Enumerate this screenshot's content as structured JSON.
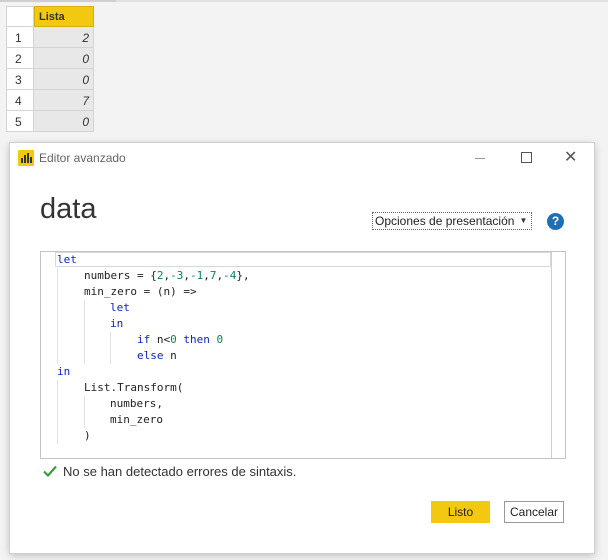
{
  "table": {
    "column_header": "Lista",
    "rows": [
      {
        "index": "1",
        "value": "2"
      },
      {
        "index": "2",
        "value": "0"
      },
      {
        "index": "3",
        "value": "0"
      },
      {
        "index": "4",
        "value": "7"
      },
      {
        "index": "5",
        "value": "0"
      }
    ]
  },
  "dialog": {
    "title": "Editor avanzado",
    "query_name": "data",
    "display_options_label": "Opciones de presentación",
    "help_label": "?",
    "close_label": "✕",
    "code": {
      "l1": "let",
      "l2_a": "numbers = {",
      "l2_n1": "2",
      "l2_n2": "-3",
      "l2_n3": "-1",
      "l2_n4": "7",
      "l2_n5": "-4",
      "l2_b": "},",
      "l3": "min_zero = (n) =>",
      "l4": "let",
      "l5": "in",
      "l6_if": "if",
      "l6_cond": " n<",
      "l6_n0": "0",
      "l6_then": "then",
      "l6_n1": "0",
      "l7_else": "else",
      "l7_n": " n",
      "l8": "in",
      "l9": "List.Transform(",
      "l10": "numbers,",
      "l11": "min_zero",
      "l12": ")"
    },
    "status_message": "No se han detectado errores de sintaxis.",
    "ok_label": "Listo",
    "cancel_label": "Cancelar"
  },
  "colors": {
    "accent": "#f2c811",
    "keyword": "#0e23c7",
    "number": "#098658",
    "success": "#3a9f3a",
    "help": "#1f6eb4"
  }
}
